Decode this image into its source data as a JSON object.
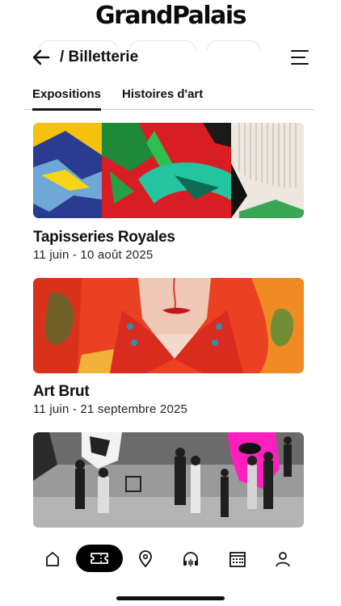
{
  "brand": {
    "name": "GrandPalais"
  },
  "header": {
    "breadcrumb": "/ Billetterie",
    "back_icon": "arrow-left-icon",
    "menu_icon": "hamburger-menu-icon"
  },
  "tabs": [
    {
      "label": "Expositions",
      "active": true
    },
    {
      "label": "Histoires d'art",
      "active": false
    }
  ],
  "exhibitions": [
    {
      "title": "Tapisseries Royales",
      "dates": "11 juin - 10 août 2025"
    },
    {
      "title": "Art Brut",
      "dates": "11 juin - 21 septembre 2025"
    },
    {
      "title": "",
      "dates": ""
    }
  ],
  "bottom_nav": [
    {
      "icon": "home-icon",
      "active": false
    },
    {
      "icon": "ticket-icon",
      "active": true
    },
    {
      "icon": "map-pin-icon",
      "active": false
    },
    {
      "icon": "audioguide-headphones-icon",
      "active": false
    },
    {
      "icon": "calendar-icon",
      "active": false
    },
    {
      "icon": "profile-icon",
      "active": false
    }
  ],
  "colors": {
    "text": "#111111",
    "accent": "#000000",
    "divider": "#cfcfcf"
  }
}
